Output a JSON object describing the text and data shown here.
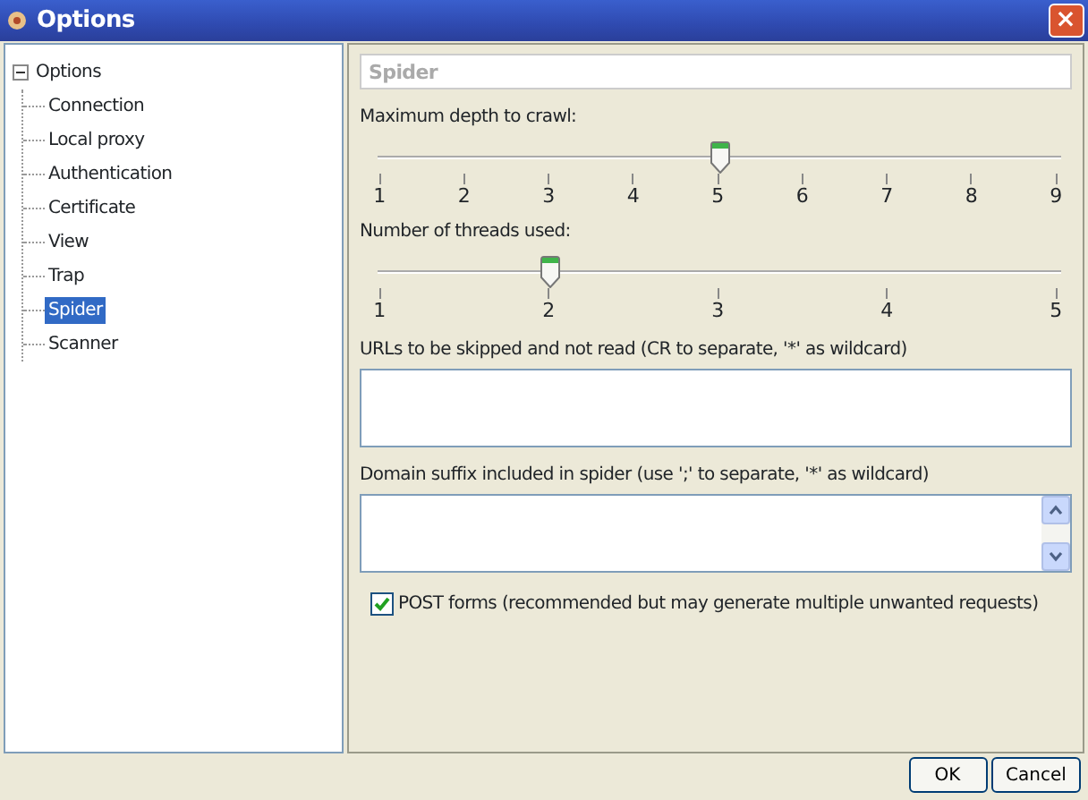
{
  "window": {
    "title": "Options",
    "close": "×"
  },
  "tree": {
    "label": "Options",
    "expanded": true,
    "children": [
      {
        "label": "Connection",
        "selected": false
      },
      {
        "label": "Local proxy",
        "selected": false
      },
      {
        "label": "Authentication",
        "selected": false
      },
      {
        "label": "Certificate",
        "selected": false
      },
      {
        "label": "View",
        "selected": false
      },
      {
        "label": "Trap",
        "selected": false
      },
      {
        "label": "Spider",
        "selected": true
      },
      {
        "label": "Scanner",
        "selected": false
      }
    ]
  },
  "panel": {
    "title": "Spider",
    "sliders": [
      {
        "label": "Maximum depth to crawl:",
        "level": 0.5,
        "ticks": [
          "1",
          "2",
          "3",
          "4",
          "5",
          "6",
          "7",
          "8",
          "9"
        ]
      },
      {
        "label": "Number of threads used:",
        "level": 0.25,
        "ticks": [
          "1",
          "2",
          "3",
          "4",
          "5"
        ]
      }
    ],
    "text_areas": [
      {
        "label": "URLs to be skipped and not read (CR to separate, '*' as wildcard)",
        "scrollbar": false
      },
      {
        "label": "Domain suffix included in spider (use ';' to separate, '*' as wildcard)",
        "scrollbar": true
      }
    ],
    "checkbox": {
      "label": "POST forms (recommended but may generate multiple unwanted requests)",
      "checked": true
    }
  },
  "buttons": [
    "OK",
    "Cancel"
  ]
}
